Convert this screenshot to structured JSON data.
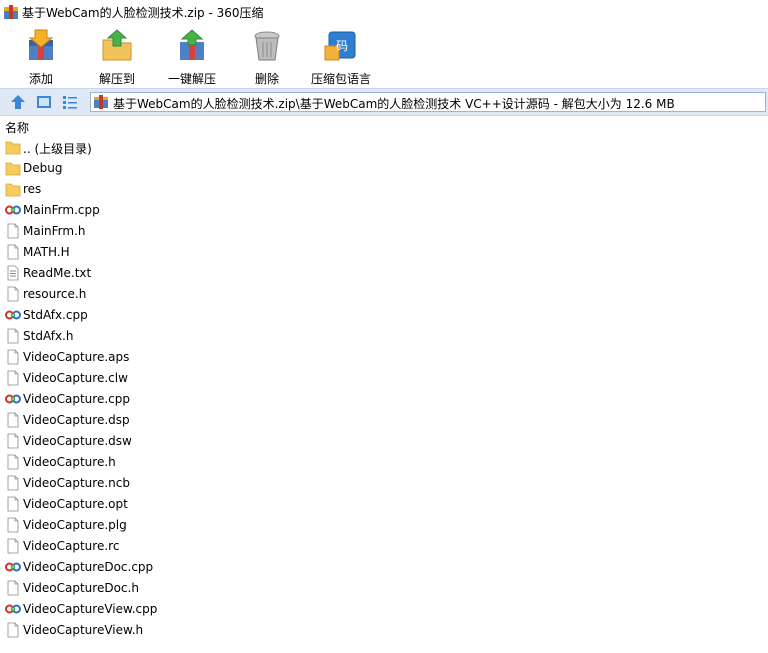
{
  "window": {
    "title": "基于WebCam的人脸检测技术.zip - 360压缩"
  },
  "toolbar": [
    {
      "label": "添加",
      "icon": "add-archive-icon"
    },
    {
      "label": "解压到",
      "icon": "extract-to-icon"
    },
    {
      "label": "一键解压",
      "icon": "one-click-extract-icon"
    },
    {
      "label": "删除",
      "icon": "delete-icon"
    },
    {
      "label": "压缩包语言",
      "icon": "archive-language-icon"
    }
  ],
  "address": {
    "path": "基于WebCam的人脸检测技术.zip\\基于WebCam的人脸检测技术 VC++设计源码 - 解包大小为 12.6 MB"
  },
  "list": {
    "column_name": "名称",
    "files": [
      {
        "name": ".. (上级目录)",
        "type": "folder"
      },
      {
        "name": "Debug",
        "type": "folder"
      },
      {
        "name": "res",
        "type": "folder"
      },
      {
        "name": "MainFrm.cpp",
        "type": "cpp"
      },
      {
        "name": "MainFrm.h",
        "type": "file"
      },
      {
        "name": "MATH.H",
        "type": "file"
      },
      {
        "name": "ReadMe.txt",
        "type": "txt"
      },
      {
        "name": "resource.h",
        "type": "file"
      },
      {
        "name": "StdAfx.cpp",
        "type": "cpp"
      },
      {
        "name": "StdAfx.h",
        "type": "file"
      },
      {
        "name": "VideoCapture.aps",
        "type": "file"
      },
      {
        "name": "VideoCapture.clw",
        "type": "file"
      },
      {
        "name": "VideoCapture.cpp",
        "type": "cpp"
      },
      {
        "name": "VideoCapture.dsp",
        "type": "file"
      },
      {
        "name": "VideoCapture.dsw",
        "type": "file"
      },
      {
        "name": "VideoCapture.h",
        "type": "file"
      },
      {
        "name": "VideoCapture.ncb",
        "type": "file"
      },
      {
        "name": "VideoCapture.opt",
        "type": "file"
      },
      {
        "name": "VideoCapture.plg",
        "type": "file"
      },
      {
        "name": "VideoCapture.rc",
        "type": "file"
      },
      {
        "name": "VideoCaptureDoc.cpp",
        "type": "cpp"
      },
      {
        "name": "VideoCaptureDoc.h",
        "type": "file"
      },
      {
        "name": "VideoCaptureView.cpp",
        "type": "cpp"
      },
      {
        "name": "VideoCaptureView.h",
        "type": "file"
      }
    ]
  }
}
